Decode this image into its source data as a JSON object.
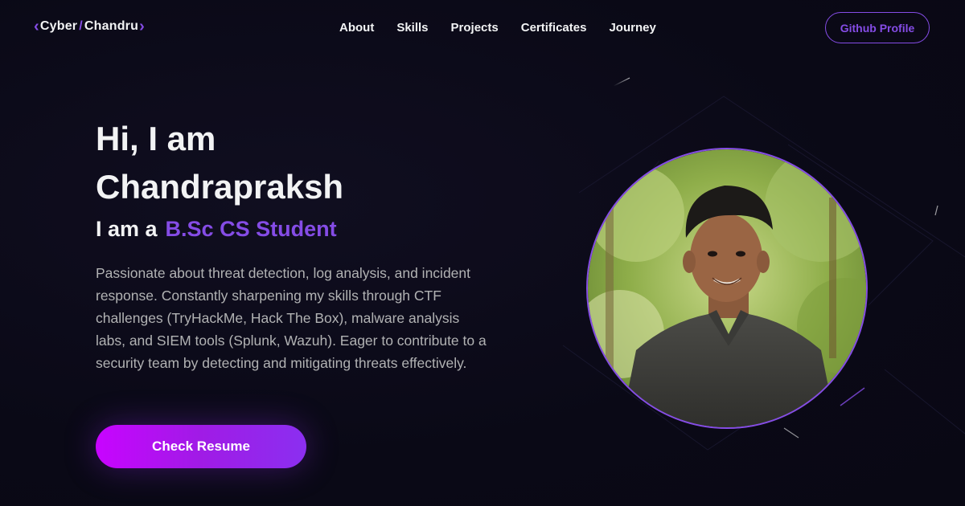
{
  "nav": {
    "logo": {
      "left": "Cyber",
      "slash": "/",
      "right": "Chandru"
    },
    "links": [
      "About",
      "Skills",
      "Projects",
      "Certificates",
      "Journey"
    ],
    "github_label": "Github Profile"
  },
  "hero": {
    "greeting_line1": "Hi, I am",
    "greeting_line2": "Chandrapraksh",
    "role_prefix": "I am a",
    "role": "B.Sc CS Student",
    "description": "Passionate about threat detection, log analysis, and incident response. Constantly sharpening my skills through CTF challenges (TryHackMe, Hack The Box), malware analysis labs, and SIEM tools (Splunk, Wazuh). Eager to contribute to a security team by detecting and mitigating threats effectively.",
    "resume_label": "Check Resume"
  },
  "colors": {
    "accent": "#854ce6",
    "button_gradient_start": "#c804ff",
    "button_gradient_end": "#8b2ff0",
    "background": "#0b0a18",
    "text_primary": "#f2f3f4",
    "text_secondary": "#b1b2b3"
  },
  "icons": {
    "logo_left": "chevron-left-icon",
    "logo_right": "chevron-right-icon"
  }
}
